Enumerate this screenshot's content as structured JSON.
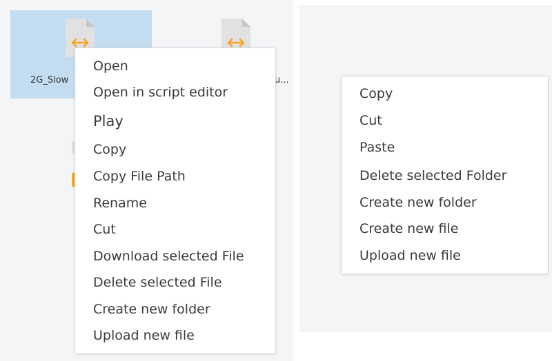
{
  "left_panel": {
    "file_selected": {
      "name": "2G_Slow",
      "icon": "file-arrows-icon"
    },
    "file_other": {
      "name": "u...",
      "icon": "file-arrows-icon"
    },
    "context_menu": {
      "items": [
        {
          "label": "Open"
        },
        {
          "label": "Open in script editor"
        },
        {
          "label": "Play"
        },
        {
          "label": "Copy"
        },
        {
          "label": "Copy File Path"
        },
        {
          "label": "Rename"
        },
        {
          "label": "Cut"
        },
        {
          "label": "Download selected File"
        },
        {
          "label": "Delete selected File"
        },
        {
          "label": "Create new folder"
        },
        {
          "label": "Upload new file"
        }
      ]
    }
  },
  "right_panel": {
    "context_menu": {
      "items": [
        {
          "label": "Copy"
        },
        {
          "label": "Cut"
        },
        {
          "label": "Paste"
        },
        {
          "label": "Delete selected Folder"
        },
        {
          "label": "Create new folder"
        },
        {
          "label": "Create new file"
        },
        {
          "label": "Upload new file"
        }
      ]
    }
  },
  "colors": {
    "panel_bg": "#f4f5f7",
    "selection_bg": "#c3dcf0",
    "icon_accent": "#f5a623",
    "icon_page": "#e1e1e1",
    "menu_text": "#3a3a3a"
  }
}
